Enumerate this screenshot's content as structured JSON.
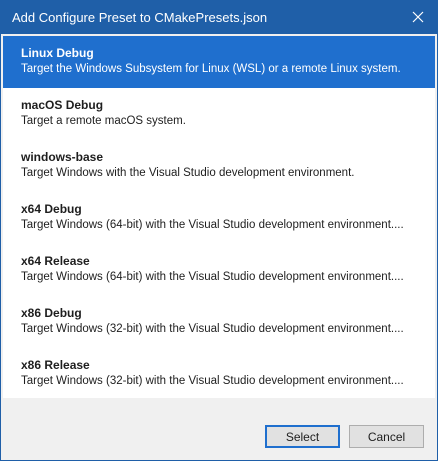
{
  "window": {
    "title": "Add Configure Preset to CMakePresets.json",
    "close_label": "×",
    "accent_color": "#1f5fa8",
    "selection_color": "#1f6fce"
  },
  "presets": [
    {
      "name": "Linux Debug",
      "description": "Target the Windows Subsystem for Linux (WSL) or a remote Linux system.",
      "selected": true
    },
    {
      "name": "macOS Debug",
      "description": "Target a remote macOS system.",
      "selected": false
    },
    {
      "name": "windows-base",
      "description": "Target Windows with the Visual Studio development environment.",
      "selected": false
    },
    {
      "name": "x64 Debug",
      "description": "Target Windows (64-bit) with the Visual Studio development environment....",
      "selected": false
    },
    {
      "name": "x64 Release",
      "description": "Target Windows (64-bit) with the Visual Studio development environment....",
      "selected": false
    },
    {
      "name": "x86 Debug",
      "description": "Target Windows (32-bit) with the Visual Studio development environment....",
      "selected": false
    },
    {
      "name": "x86 Release",
      "description": "Target Windows (32-bit) with the Visual Studio development environment....",
      "selected": false
    }
  ],
  "buttons": {
    "select_label": "Select",
    "cancel_label": "Cancel"
  }
}
